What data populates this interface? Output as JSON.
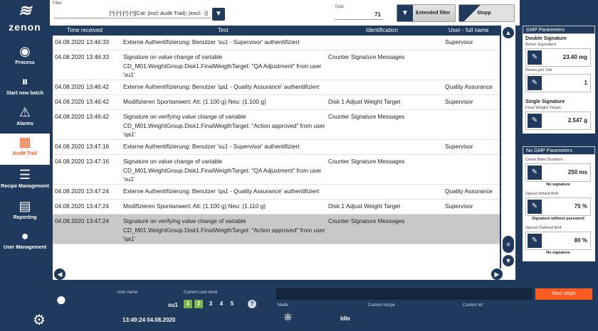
{
  "app": {
    "logo_text": "zenon"
  },
  "sidebar": {
    "items": [
      {
        "label": "Process",
        "icon": "eye-icon"
      },
      {
        "label": "Start new batch",
        "icon": "pause-icon"
      },
      {
        "label": "Alarms",
        "icon": "alarm-icon"
      },
      {
        "label": "Audit Trail",
        "icon": "calendar-icon"
      },
      {
        "label": "Recipe Management",
        "icon": "list-icon"
      },
      {
        "label": "Reporting",
        "icon": "report-icon"
      },
      {
        "label": "User Management",
        "icon": "user-icon"
      }
    ]
  },
  "filter": {
    "label": "Filter",
    "value": "[*]-[*]-[*]-[*][Cat: (incl: Audit Trail); (excl: -)]"
  },
  "total": {
    "label": "Total",
    "value": "71"
  },
  "buttons": {
    "extended_filter": "Extended filter",
    "stopp": "Stopp"
  },
  "table": {
    "columns": [
      "Time received",
      "Text",
      "Identification",
      "User - full name"
    ],
    "rows": [
      {
        "time": "04.08.2020 13:46:33",
        "text": "Externe Authentifizierung: Benutzer 'su1 - Supervisor' authentifiziert",
        "ident": "",
        "user": "Supervisor"
      },
      {
        "time": "04.08.2020 13:46:33",
        "text": "Signature on value change of variable CD_M01.WeightGroup.Disk1.FinalWeigthTarget: \"QA Adjustment\" from user 'su1'",
        "ident": "Counter Signature Messages",
        "user": ""
      },
      {
        "time": "04.08.2020 13:46:42",
        "text": "Externe Authentifizierung: Benutzer 'qa1 - Quality Assurance' authentifiziert",
        "ident": "",
        "user": "Quality Assurance"
      },
      {
        "time": "04.08.2020 13:46:42",
        "text": "Modifizieren Spontanwert: Alt: (1.100 g)  Neu: (1.100 g)",
        "ident": "Disk 1 Adjust Weight Target",
        "user": "Supervisor"
      },
      {
        "time": "04.08.2020 13:46:42",
        "text": "Signature on verifying value change of variable CD_M01.WeightGroup.Disk1.FinalWeigthTarget: \"Action approved\" from user 'qa1'",
        "ident": "Counter Signature Messages",
        "user": ""
      },
      {
        "time": "04.08.2020 13:47:16",
        "text": "Externe Authentifizierung: Benutzer 'su1 - Supervisor' authentifiziert",
        "ident": "",
        "user": "Supervisor"
      },
      {
        "time": "04.08.2020 13:47:16",
        "text": "Signature on value change of variable CD_M01.WeightGroup.Disk1.FinalWeigthTarget: \"QA Adjustment\" from user 'su1'",
        "ident": "Counter Signature Messages",
        "user": ""
      },
      {
        "time": "04.08.2020 13:47:24",
        "text": "Externe Authentifizierung: Benutzer 'qa1 - Quality Assurance' authentifiziert",
        "ident": "",
        "user": "Quality Assurance"
      },
      {
        "time": "04.08.2020 13:47:24",
        "text": "Modifizieren Spontanwert: Alt: (1.100 g)  Neu: (1.110 g)",
        "ident": "Disk 1 Adjust Weight Target",
        "user": "Supervisor"
      },
      {
        "time": "04.08.2020 13:47:24",
        "text": "Signature on verifying value change of variable CD_M01.WeightGroup.Disk1.FinalWeigthTarget: \"Action approved\" from user 'qa1'",
        "ident": "Counter Signature Messages",
        "user": ""
      }
    ]
  },
  "gmp": {
    "title": "GMP Parameters",
    "double_signature": "Double Signature",
    "active_ingredient_label": "Active Ingredient",
    "active_ingredient_value": "23.40 mg",
    "doses_label": "Doses per Vial",
    "doses_value": "1",
    "single_signature": "Single Signature",
    "final_weight_label": "Final Weight Target",
    "final_weight_value": "2.547 g"
  },
  "nogmp": {
    "title": "No GMP Parameters",
    "clean_blow_label": "Clean Blow Duration",
    "clean_blow_value": "250 ms",
    "clean_blow_note": "No signature",
    "infeed_label": "Speed Infeed Belt",
    "infeed_value": "75 %",
    "infeed_note": "Signature without password",
    "outfeed_label": "Speed Outfeed Belt",
    "outfeed_value": "80 %",
    "outfeed_note": "No signature"
  },
  "bottom": {
    "user_name_label": "User name",
    "user_name": "su1",
    "user_level_label": "Current user level",
    "levels": [
      "1",
      "2",
      "3",
      "4",
      "5"
    ],
    "active_levels": [
      "1",
      "2"
    ],
    "help": "?",
    "datetime": "13:49:24 04.08.2020",
    "mode_label": "Mode",
    "mode_value": "Idle",
    "recipe_label": "Current recipe",
    "lot_label": "Current lot",
    "next_steps": "Next steps"
  },
  "colors": {
    "primary": "#1f3a5c",
    "accent": "#ff5a1f",
    "level_active": "#7ab648"
  }
}
